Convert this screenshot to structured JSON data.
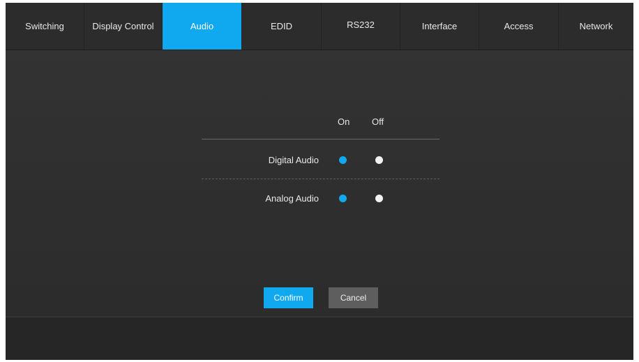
{
  "tabs": [
    {
      "label": "Switching"
    },
    {
      "label": "Display Control"
    },
    {
      "label": "Audio"
    },
    {
      "label": "EDID"
    },
    {
      "label": "RS232"
    },
    {
      "label": "Interface"
    },
    {
      "label": "Access"
    },
    {
      "label": "Network"
    }
  ],
  "active_tab": "Audio",
  "audio": {
    "col_on": "On",
    "col_off": "Off",
    "rows": [
      {
        "label": "Digital Audio",
        "selected": "On"
      },
      {
        "label": "Analog Audio",
        "selected": "On"
      }
    ]
  },
  "actions": {
    "confirm": "Confirm",
    "cancel": "Cancel"
  },
  "colors": {
    "accent": "#10a9ef",
    "background": "#2b2b2b",
    "cancel": "#5e5e5e"
  }
}
